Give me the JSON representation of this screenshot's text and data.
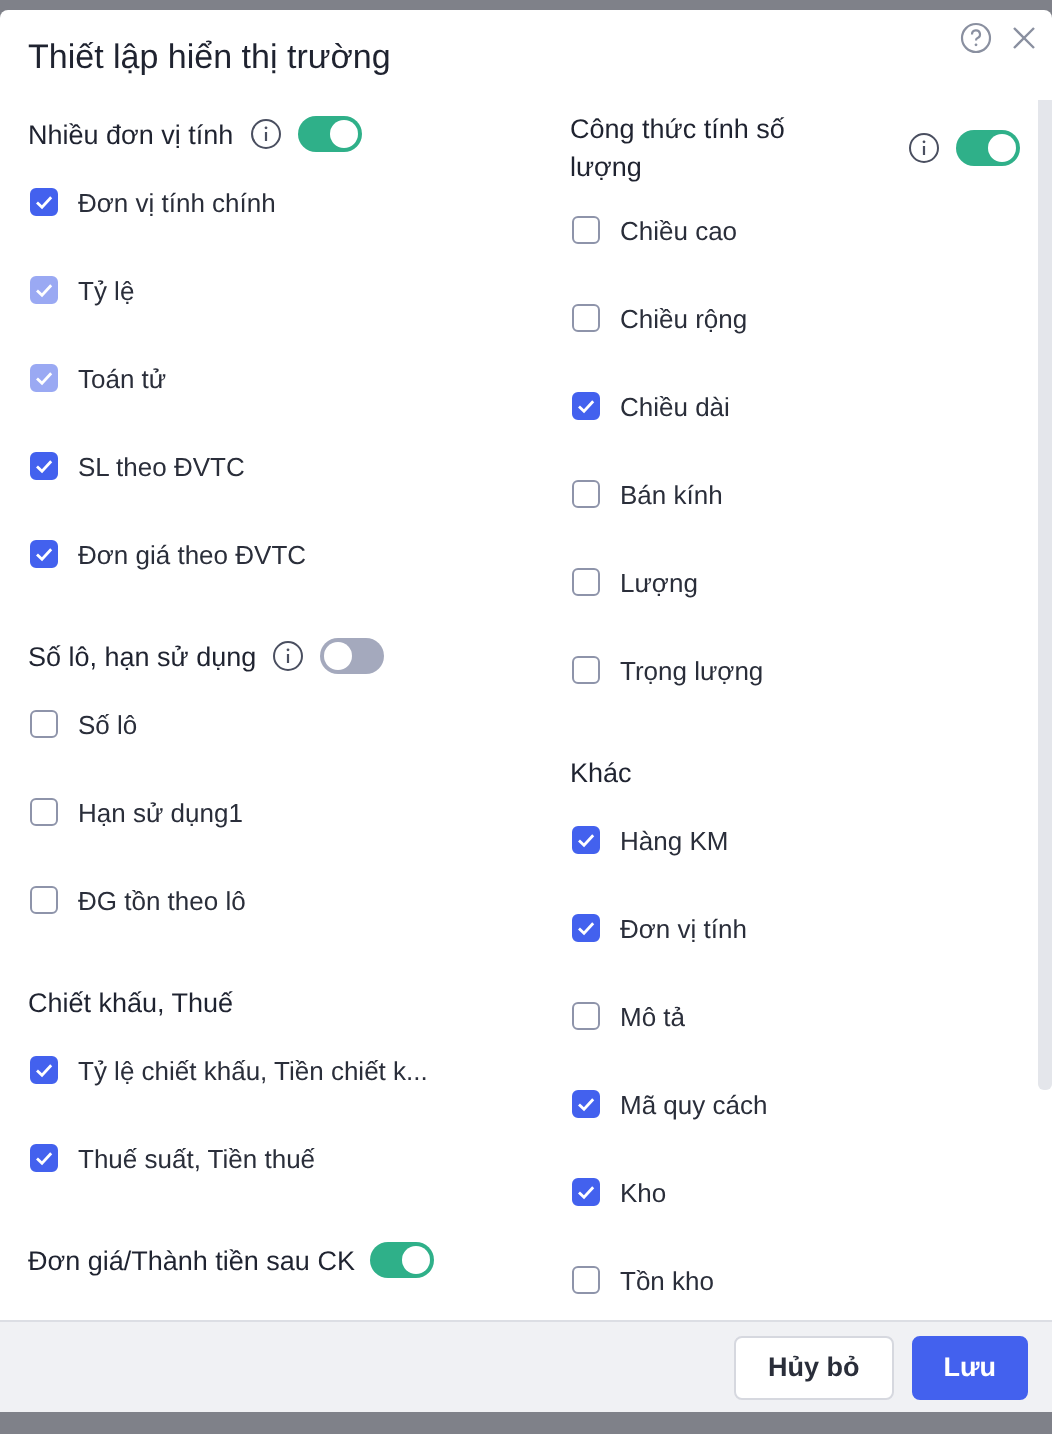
{
  "dialog": {
    "title": "Thiết lập hiển thị trường"
  },
  "columns": [
    {
      "sections": [
        {
          "title": "Nhiều đơn vị tính",
          "info": true,
          "toggle": true,
          "items": [
            {
              "label": "Đơn vị tính chính",
              "checked": true,
              "disabled": false
            },
            {
              "label": "Tỷ lệ",
              "checked": true,
              "disabled": true
            },
            {
              "label": "Toán tử",
              "checked": true,
              "disabled": true
            },
            {
              "label": "SL theo ĐVTC",
              "checked": true,
              "disabled": false
            },
            {
              "label": "Đơn giá theo ĐVTC",
              "checked": true,
              "disabled": false
            }
          ]
        },
        {
          "title": "Số lô, hạn sử dụng",
          "info": true,
          "toggle": false,
          "items": [
            {
              "label": "Số lô",
              "checked": false,
              "disabled": false
            },
            {
              "label": "Hạn sử dụng1",
              "checked": false,
              "disabled": false
            },
            {
              "label": "ĐG tồn theo lô",
              "checked": false,
              "disabled": false
            }
          ]
        },
        {
          "title": "Chiết khấu, Thuế",
          "items": [
            {
              "label": "Tỷ lệ chiết khấu, Tiền chiết k...",
              "checked": true,
              "disabled": false
            },
            {
              "label": "Thuế suất, Tiền thuế",
              "checked": true,
              "disabled": false
            }
          ]
        },
        {
          "title": "Đơn giá/Thành tiền sau CK",
          "toggle": true
        }
      ]
    },
    {
      "sections": [
        {
          "title": "Công thức tính số lượng",
          "info": true,
          "toggle": true,
          "items": [
            {
              "label": "Chiều cao",
              "checked": false,
              "disabled": false
            },
            {
              "label": "Chiều rộng",
              "checked": false,
              "disabled": false
            },
            {
              "label": "Chiều dài",
              "checked": true,
              "disabled": false
            },
            {
              "label": "Bán kính",
              "checked": false,
              "disabled": false
            },
            {
              "label": "Lượng",
              "checked": false,
              "disabled": false
            },
            {
              "label": "Trọng lượng",
              "checked": false,
              "disabled": false
            }
          ]
        },
        {
          "title": "Khác",
          "items": [
            {
              "label": "Hàng KM",
              "checked": true,
              "disabled": false
            },
            {
              "label": "Đơn vị tính",
              "checked": true,
              "disabled": false
            },
            {
              "label": "Mô tả",
              "checked": false,
              "disabled": false
            },
            {
              "label": "Mã quy cách",
              "checked": true,
              "disabled": false
            },
            {
              "label": "Kho",
              "checked": true,
              "disabled": false
            },
            {
              "label": "Tồn kho",
              "checked": false,
              "disabled": false
            }
          ]
        }
      ]
    }
  ],
  "buttons": [
    {
      "label": "Hủy bỏ",
      "kind": "secondary"
    },
    {
      "label": "Lưu",
      "kind": "primary"
    }
  ]
}
